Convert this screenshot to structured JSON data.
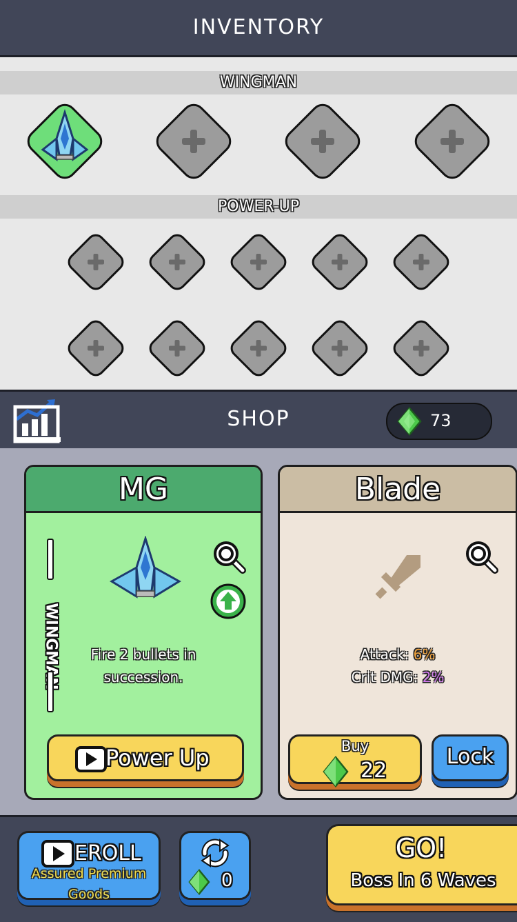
{
  "header": {
    "title": "INVENTORY"
  },
  "inventory": {
    "wingman_label": "WINGMAN",
    "powerup_label": "POWER-UP"
  },
  "shop": {
    "title": "SHOP",
    "gems": "73"
  },
  "cards": {
    "mg": {
      "title": "MG",
      "category": "WINGMAN",
      "desc_line1": "Fire 2 bullets in",
      "desc_line2": "succession.",
      "action_label": "Power Up",
      "header_color": "#4caa6e",
      "body_color": "#a2f09e"
    },
    "blade": {
      "title": "Blade",
      "stat1_label": "Attack:",
      "stat1_value": "6%",
      "stat2_label": "Crit DMG:",
      "stat2_value": "2%",
      "buy_label": "Buy",
      "price": "22",
      "lock_label": "Lock",
      "header_color": "#cbbda4",
      "body_color": "#efe5da"
    }
  },
  "bottom": {
    "reroll_label": "EROLL",
    "reroll_sub1": "Assured Premium",
    "reroll_sub2": "Goods",
    "refresh_cost": "0",
    "go_label": "GO!",
    "go_sub": "Boss In 6 Waves"
  },
  "colors": {
    "panel_dark": "#414658",
    "stat_attack": "#f0a23c",
    "stat_crit": "#d37bf0",
    "gem": "#4cc94a"
  }
}
